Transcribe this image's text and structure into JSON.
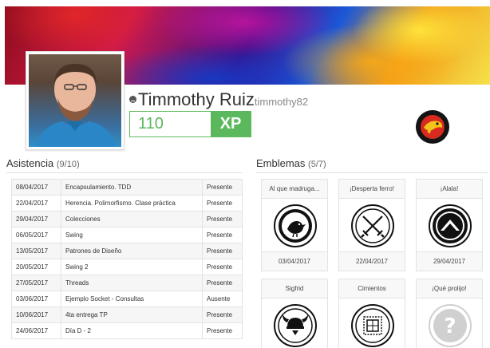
{
  "profile": {
    "name": "Timmothy Ruiz",
    "handle": "timmothy82",
    "xp_value": "110",
    "xp_label": "XP"
  },
  "attendance": {
    "title": "Asistencia",
    "count": "(9/10)",
    "rows": [
      {
        "date": "08/04/2017",
        "topic": "Encapsulamiento. TDD",
        "status": "Presente"
      },
      {
        "date": "22/04/2017",
        "topic": "Herencia. Polimorfismo. Clase práctica",
        "status": "Presente"
      },
      {
        "date": "29/04/2017",
        "topic": "Colecciones",
        "status": "Presente"
      },
      {
        "date": "06/05/2017",
        "topic": "Swing",
        "status": "Presente"
      },
      {
        "date": "13/05/2017",
        "topic": "Patrones de Diseño",
        "status": "Presente"
      },
      {
        "date": "20/05/2017",
        "topic": "Swing 2",
        "status": "Presente"
      },
      {
        "date": "27/05/2017",
        "topic": "Threads",
        "status": "Presente"
      },
      {
        "date": "03/06/2017",
        "topic": "Ejemplo Socket - Consultas",
        "status": "Ausente"
      },
      {
        "date": "10/06/2017",
        "topic": "4ta entrega TP",
        "status": "Presente"
      },
      {
        "date": "24/06/2017",
        "topic": "Día D - 2",
        "status": "Presente"
      }
    ]
  },
  "badges": {
    "title": "Emblemas",
    "count": "(5/7)",
    "items": [
      {
        "title": "Al que madruga...",
        "date": "03/04/2017",
        "icon": "bird-icon"
      },
      {
        "title": "¡Desperta ferro!",
        "date": "22/04/2017",
        "icon": "crossed-swords-icon"
      },
      {
        "title": "¡Alala!",
        "date": "29/04/2017",
        "icon": "spartan-shield-icon"
      },
      {
        "title": "Sigfrid",
        "date": "",
        "icon": "viking-helmet-icon"
      },
      {
        "title": "Cimientos",
        "date": "",
        "icon": "blueprint-icon"
      },
      {
        "title": "¡Qué prolijo!",
        "date": "",
        "icon": "question-mark-icon"
      }
    ]
  },
  "colors": {
    "xp_green": "#5cb85c"
  }
}
